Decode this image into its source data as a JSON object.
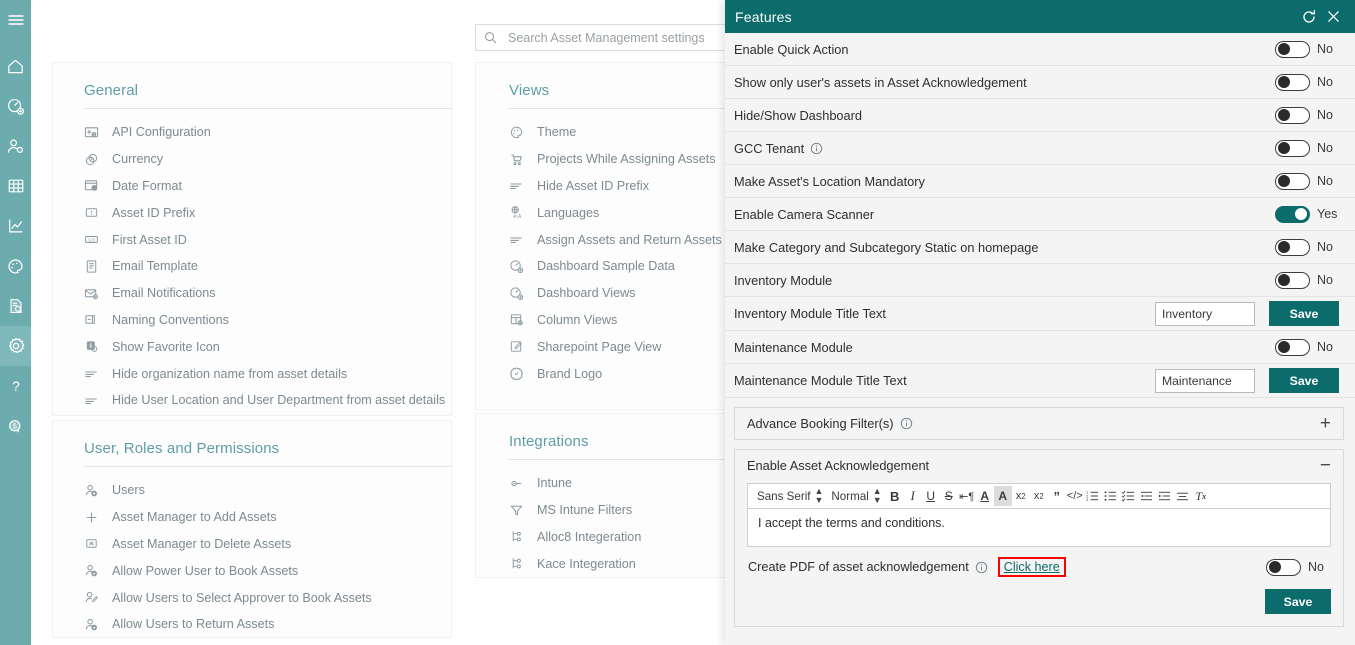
{
  "rail": {
    "items": [
      {
        "name": "menu-icon",
        "label": "Menu",
        "active": false
      },
      {
        "name": "home-icon",
        "label": "Home",
        "active": false
      },
      {
        "name": "dashboard-add-icon",
        "label": "Dashboard",
        "active": false
      },
      {
        "name": "user-settings-icon",
        "label": "Users",
        "active": false
      },
      {
        "name": "table-icon",
        "label": "Assets Table",
        "active": false
      },
      {
        "name": "chart-icon",
        "label": "Reports",
        "active": false
      },
      {
        "name": "theme-palette-icon",
        "label": "Theme",
        "active": false
      },
      {
        "name": "document-search-icon",
        "label": "Audit",
        "active": false
      },
      {
        "name": "gear-icon",
        "label": "Settings",
        "active": true
      },
      {
        "name": "question-mark-icon",
        "label": "Help",
        "active": false
      },
      {
        "name": "money-icon",
        "label": "Billing",
        "active": false
      }
    ]
  },
  "search": {
    "placeholder": "Search Asset Management settings",
    "value": "",
    "icon": "search-icon"
  },
  "sections": {
    "general": {
      "title": "General",
      "items": [
        {
          "icon": "api-configuration-icon",
          "label": "API Configuration"
        },
        {
          "icon": "currency-icon",
          "label": "Currency"
        },
        {
          "icon": "date-format-icon",
          "label": "Date Format"
        },
        {
          "icon": "text-box-icon",
          "label": "Asset ID Prefix"
        },
        {
          "icon": "number-box-icon",
          "label": "First Asset ID"
        },
        {
          "icon": "email-template-icon",
          "label": "Email Template"
        },
        {
          "icon": "email-notification-icon",
          "label": "Email Notifications"
        },
        {
          "icon": "naming-convention-icon",
          "label": "Naming Conventions"
        },
        {
          "icon": "favorite-badge-icon",
          "label": "Show Favorite Icon"
        },
        {
          "icon": "hide-lines-icon",
          "label": "Hide organization name from asset details"
        },
        {
          "icon": "hide-lines-icon",
          "label": "Hide User Location and User Department from asset details"
        }
      ]
    },
    "user_roles": {
      "title": "User, Roles and Permissions",
      "items": [
        {
          "icon": "user-add-icon",
          "label": "Users"
        },
        {
          "icon": "plus-icon",
          "label": "Asset Manager to Add Assets"
        },
        {
          "icon": "delete-box-icon",
          "label": "Asset Manager to Delete Assets"
        },
        {
          "icon": "user-check-icon",
          "label": "Allow Power User to Book Assets"
        },
        {
          "icon": "user-approver-icon",
          "label": "Allow Users to Select Approver to Book Assets"
        },
        {
          "icon": "user-check-icon",
          "label": "Allow Users to Return Assets"
        }
      ]
    },
    "views": {
      "title": "Views",
      "items": [
        {
          "icon": "palette-icon",
          "label": "Theme"
        },
        {
          "icon": "cart-icon",
          "label": "Projects While Assigning Assets"
        },
        {
          "icon": "hide-lines-icon",
          "label": "Hide Asset ID Prefix"
        },
        {
          "icon": "languages-icon",
          "label": "Languages"
        },
        {
          "icon": "hide-lines-icon",
          "label": "Assign Assets and Return Assets Options"
        },
        {
          "icon": "dashboard-add-icon",
          "label": "Dashboard Sample Data"
        },
        {
          "icon": "dashboard-add-icon",
          "label": "Dashboard Views"
        },
        {
          "icon": "column-views-icon",
          "label": "Column Views"
        },
        {
          "icon": "edit-page-icon",
          "label": "Sharepoint Page View"
        },
        {
          "icon": "brand-badge-icon",
          "label": "Brand Logo"
        }
      ]
    },
    "integrations": {
      "title": "Integrations",
      "items": [
        {
          "icon": "intune-icon",
          "label": "Intune"
        },
        {
          "icon": "filter-icon",
          "label": "MS Intune Filters"
        },
        {
          "icon": "integration-node-icon",
          "label": "Alloc8 Integeration"
        },
        {
          "icon": "integration-node-icon",
          "label": "Kace Integeration"
        }
      ]
    }
  },
  "features_panel": {
    "title": "Features",
    "refresh_icon": "refresh-icon",
    "close_icon": "close-icon",
    "rows": [
      {
        "label": "Enable Quick Action",
        "type": "toggle",
        "state": "No",
        "on": false,
        "info": false
      },
      {
        "label": "Show only user's assets in Asset Acknowledgement",
        "type": "toggle",
        "state": "No",
        "on": false,
        "info": false
      },
      {
        "label": "Hide/Show Dashboard",
        "type": "toggle",
        "state": "No",
        "on": false,
        "info": false
      },
      {
        "label": "GCC Tenant",
        "type": "toggle",
        "state": "No",
        "on": false,
        "info": true
      },
      {
        "label": "Make Asset's Location Mandatory",
        "type": "toggle",
        "state": "No",
        "on": false,
        "info": false
      },
      {
        "label": "Enable Camera Scanner",
        "type": "toggle",
        "state": "Yes",
        "on": true,
        "info": false
      },
      {
        "label": "Make Category and Subcategory Static on homepage",
        "type": "toggle",
        "state": "No",
        "on": false,
        "info": false
      },
      {
        "label": "Inventory Module",
        "type": "toggle",
        "state": "No",
        "on": false,
        "info": false
      },
      {
        "label": "Inventory Module Title Text",
        "type": "input",
        "value": "Inventory",
        "button": "Save",
        "info": false
      },
      {
        "label": "Maintenance Module",
        "type": "toggle",
        "state": "No",
        "on": false,
        "info": false
      },
      {
        "label": "Maintenance Module Title Text",
        "type": "input",
        "value": "Maintenance",
        "button": "Save",
        "info": false
      }
    ],
    "advance_booking": {
      "label": "Advance Booking Filter(s)",
      "info": true,
      "expander": "+",
      "expanded": false
    },
    "asset_acknowledgement": {
      "label": "Enable Asset Acknowledgement",
      "expander": "−",
      "expanded": true,
      "editor": {
        "font_family": "Sans Serif",
        "font_size": "Normal",
        "content": "I accept the terms and conditions.",
        "tools": [
          {
            "name": "bold-icon",
            "glyph": "B"
          },
          {
            "name": "italic-icon",
            "glyph": "I"
          },
          {
            "name": "underline-icon",
            "glyph": "U"
          },
          {
            "name": "strikethrough-icon",
            "glyph": "S"
          },
          {
            "name": "text-direction-icon",
            "glyph": "¶"
          },
          {
            "name": "text-color-icon",
            "glyph": "A"
          },
          {
            "name": "background-color-icon",
            "glyph": "A"
          },
          {
            "name": "subscript-icon",
            "glyph": "x₂"
          },
          {
            "name": "superscript-icon",
            "glyph": "x²"
          },
          {
            "name": "blockquote-icon",
            "glyph": "”"
          },
          {
            "name": "code-block-icon",
            "glyph": "‹›"
          },
          {
            "name": "ordered-list-icon",
            "glyph": "☰"
          },
          {
            "name": "bullet-list-icon",
            "glyph": "☰"
          },
          {
            "name": "check-list-icon",
            "glyph": "☰"
          },
          {
            "name": "outdent-icon",
            "glyph": "⇤"
          },
          {
            "name": "indent-icon",
            "glyph": "⇥"
          },
          {
            "name": "align-icon",
            "glyph": "≡"
          },
          {
            "name": "clear-format-icon",
            "glyph": "Tx"
          }
        ]
      },
      "pdf_row": {
        "label": "Create PDF of asset acknowledgement",
        "info": true,
        "link": "Click here",
        "state": "No",
        "on": false
      },
      "save_button": "Save"
    }
  },
  "colors": {
    "brand_teal": "#0c6b6b",
    "rail_teal": "#6cabae",
    "rail_active": "#7fb8bb",
    "section_heading": "#5f9ea6",
    "highlight_red": "#ff0000",
    "panel_bg": "#f4f4f4"
  }
}
